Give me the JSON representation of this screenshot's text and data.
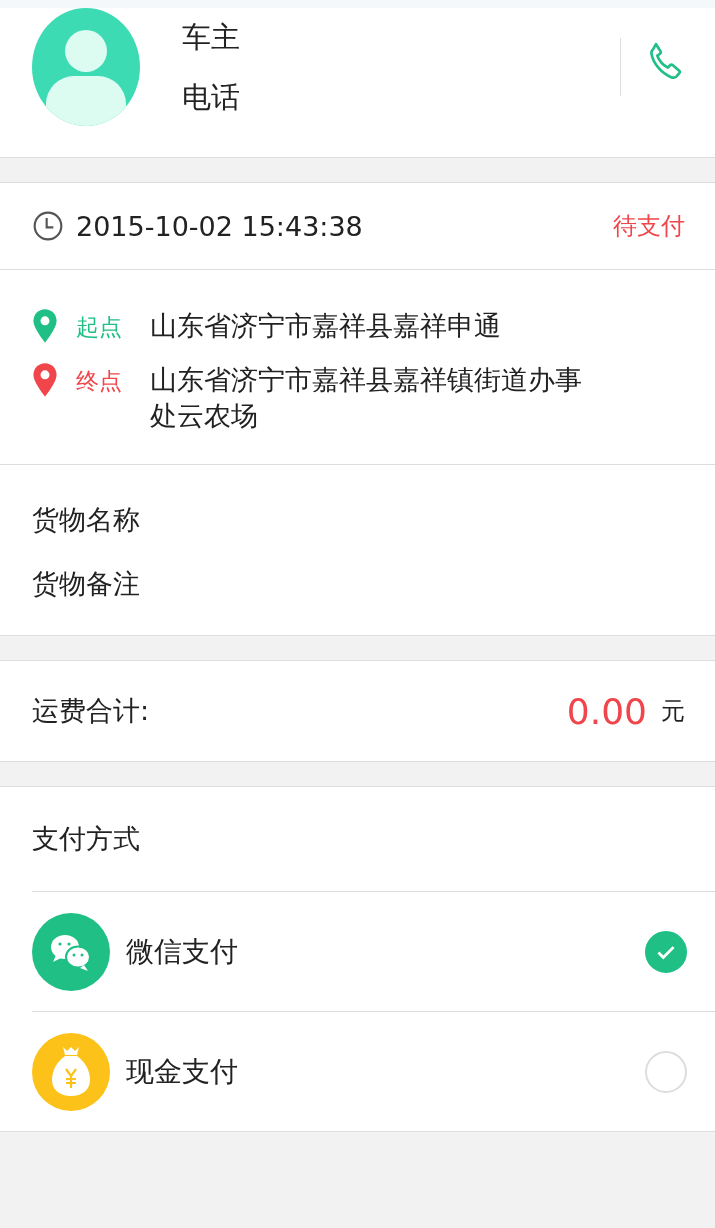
{
  "driver": {
    "name": "车主",
    "phone": "电话"
  },
  "order": {
    "time": "2015-10-02 15:43:38",
    "status": "待支付"
  },
  "route": [
    {
      "label": "起点",
      "address": "山东省济宁市嘉祥县嘉祥申通",
      "color": "#1fbf85"
    },
    {
      "label": "终点",
      "address": "山东省济宁市嘉祥县嘉祥镇街道办事处云农场",
      "color": "#f0464b"
    }
  ],
  "cargo": {
    "name_label": "货物名称",
    "note_label": "货物备注"
  },
  "fee": {
    "label": "运费合计:",
    "amount": "0.00",
    "unit": "元"
  },
  "payment": {
    "title": "支付方式",
    "methods": [
      {
        "kind": "wechat",
        "label": "微信支付",
        "selected": true
      },
      {
        "kind": "cash",
        "label": "现金支付",
        "selected": false
      }
    ]
  }
}
